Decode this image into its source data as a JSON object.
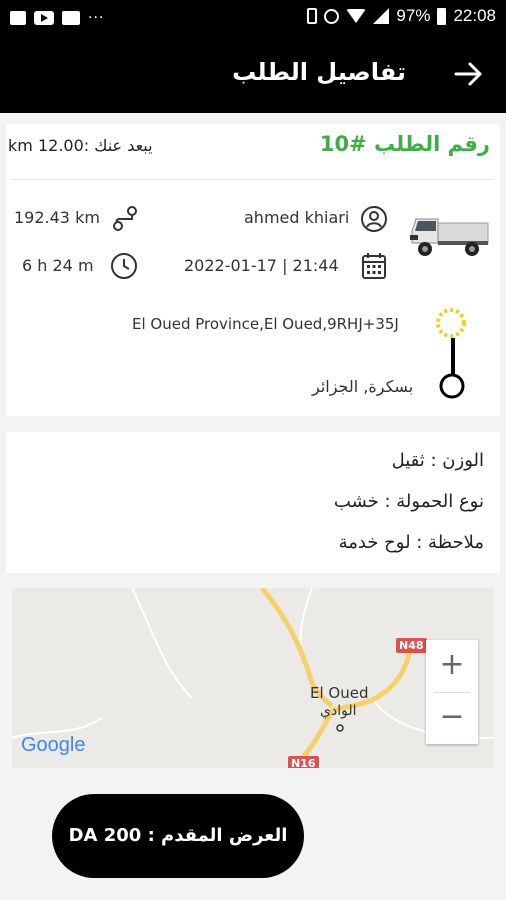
{
  "status_bar": {
    "battery": "97%",
    "time": "22:08"
  },
  "app_bar": {
    "title": "تفاصيل الطلب"
  },
  "order": {
    "number": "رقم الطلب #10",
    "distance_away": "يبعد عنك :12.00 km",
    "client_name": "ahmed khiari",
    "distance": "192.43 km",
    "datetime": "2022-01-17 | 21:44",
    "duration": "6 h 24 m",
    "origin": "El Oued Province,El Oued,9RHJ+35J",
    "destination": "بسكرة, الجزائر"
  },
  "details": {
    "weight": "الوزن : ثقيل",
    "cargo_type": "نوع الحمولة : خشب",
    "note": "ملاحظة : لوح خدمة"
  },
  "map": {
    "city_label": "El Oued",
    "city_label_ar": "الوادي",
    "road_n48": "N48",
    "road_n16": "N16",
    "logo": "Google",
    "zoom_in": "+",
    "zoom_out": "−"
  },
  "offer": {
    "label": "العرض المقدم  : DA 200"
  },
  "colors": {
    "accent_green": "#3dae48",
    "route_yellow": "#f2cd1f",
    "road_red": "#d9534f"
  }
}
